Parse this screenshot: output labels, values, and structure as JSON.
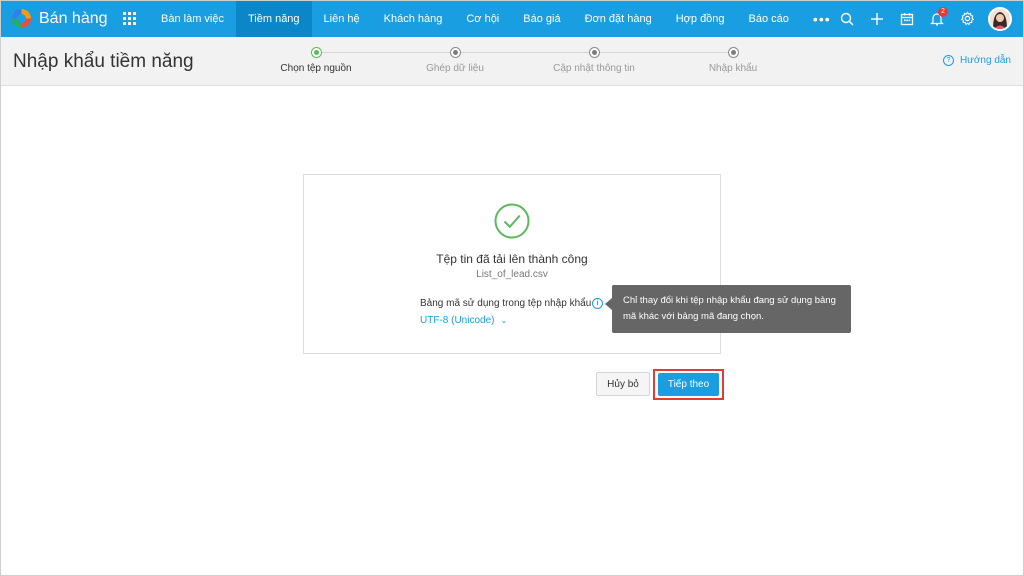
{
  "app": {
    "name": "Bán hàng"
  },
  "nav": {
    "items": [
      {
        "label": "Bàn làm việc"
      },
      {
        "label": "Tiềm năng",
        "active": true
      },
      {
        "label": "Liên hệ"
      },
      {
        "label": "Khách hàng"
      },
      {
        "label": "Cơ hội"
      },
      {
        "label": "Báo giá"
      },
      {
        "label": "Đơn đặt hàng"
      },
      {
        "label": "Hợp đồng"
      },
      {
        "label": "Báo cáo"
      }
    ],
    "more": "•••"
  },
  "topbar_icons": [
    "search-icon",
    "plus-icon",
    "calendar-icon",
    "bell-icon",
    "gear-icon",
    "avatar"
  ],
  "notifications": {
    "count": "2"
  },
  "page": {
    "title": "Nhập khẩu tiềm năng"
  },
  "steps": [
    {
      "label": "Chọn tệp nguồn",
      "active": true
    },
    {
      "label": "Ghép dữ liệu"
    },
    {
      "label": "Cập nhật thông tin"
    },
    {
      "label": "Nhập khẩu"
    }
  ],
  "help": {
    "label": "Hướng dẫn"
  },
  "upload": {
    "success_title": "Tệp tin đã tải lên thành công",
    "file_name": "List_of_lead.csv",
    "encoding_label": "Bảng mã sử dụng trong tệp nhập khẩu",
    "encoding_value": "UTF-8 (Unicode)"
  },
  "tooltip": {
    "line1": "Chỉ thay đổi khi tệp nhập khẩu đang sử dụng bảng",
    "line2": "mã khác với bảng mã đang chọn."
  },
  "buttons": {
    "cancel": "Hủy bỏ",
    "next": "Tiếp theo"
  },
  "colors": {
    "primary": "#1a9ee2",
    "active_nav": "#0b87c9",
    "success": "#5cb85c",
    "highlight": "#e53935",
    "tooltip_bg": "#666666"
  }
}
